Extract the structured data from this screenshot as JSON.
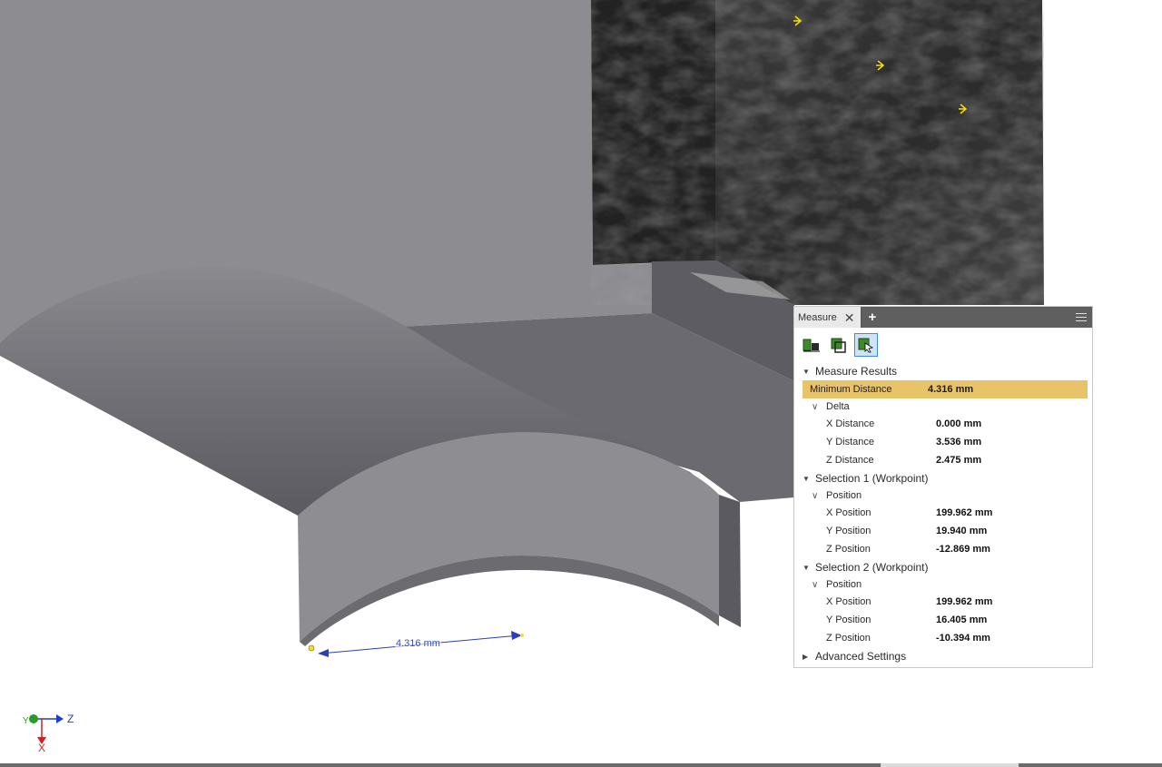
{
  "viewport": {
    "dimension_label": "4.316 mm"
  },
  "measure_panel": {
    "tab_label": "Measure",
    "add_tab_label": "+",
    "tools": [
      "measure-distance-icon",
      "measure-loop-icon",
      "measure-face-icon"
    ],
    "results_header": "Measure Results",
    "minimum_distance": {
      "label": "Minimum Distance",
      "value": "4.316 mm"
    },
    "delta": {
      "label": "Delta",
      "rows": [
        {
          "label": "X Distance",
          "value": "0.000 mm"
        },
        {
          "label": "Y Distance",
          "value": "3.536 mm"
        },
        {
          "label": "Z Distance",
          "value": "2.475 mm"
        }
      ]
    },
    "selection1": {
      "header": "Selection 1 (Workpoint)",
      "group": "Position",
      "rows": [
        {
          "label": "X Position",
          "value": "199.962 mm"
        },
        {
          "label": "Y Position",
          "value": "19.940 mm"
        },
        {
          "label": "Z Position",
          "value": "-12.869 mm"
        }
      ]
    },
    "selection2": {
      "header": "Selection 2 (Workpoint)",
      "group": "Position",
      "rows": [
        {
          "label": "X Position",
          "value": "199.962 mm"
        },
        {
          "label": "Y Position",
          "value": "16.405 mm"
        },
        {
          "label": "Z Position",
          "value": "-10.394 mm"
        }
      ]
    },
    "advanced_settings": "Advanced Settings"
  },
  "triad": {
    "x": "X",
    "y": "Y",
    "z": "Z"
  },
  "colors": {
    "highlight": "#e9c36a",
    "tab_bar": "#5f5f5f",
    "dimension": "#2b3fb8",
    "axis_x": "#d21f1f",
    "axis_y": "#2a9a2a",
    "axis_z": "#1d3fc8"
  }
}
